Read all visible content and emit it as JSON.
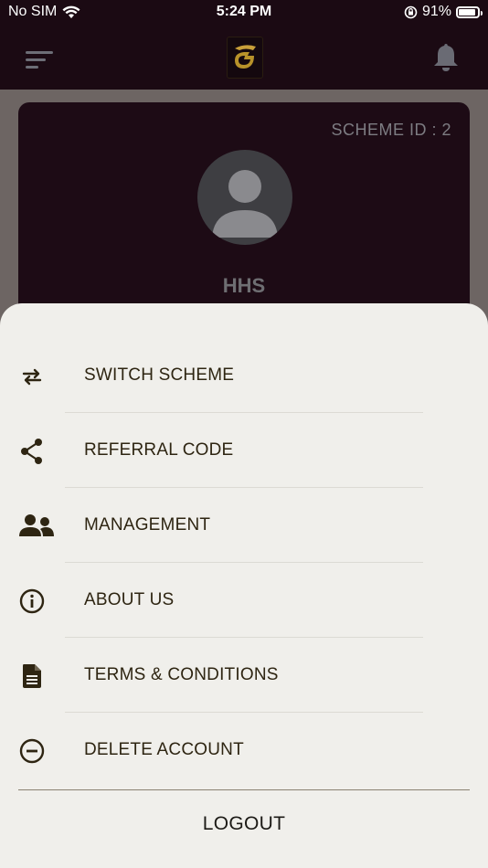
{
  "status_bar": {
    "carrier": "No SIM",
    "time": "5:24 PM",
    "battery": "91%",
    "battery_level": 0.91
  },
  "header": {
    "logo_icon": "g-logo",
    "menu_icon": "menu-icon",
    "bell_icon": "bell-icon"
  },
  "profile": {
    "scheme_id": "SCHEME ID : 2",
    "name": "HHS"
  },
  "menu": {
    "items": [
      {
        "icon": "swap-arrows-icon",
        "label": "SWITCH SCHEME"
      },
      {
        "icon": "share-icon",
        "label": "REFERRAL CODE"
      },
      {
        "icon": "people-icon",
        "label": "MANAGEMENT"
      },
      {
        "icon": "info-icon",
        "label": "ABOUT US"
      },
      {
        "icon": "document-icon",
        "label": "TERMS & CONDITIONS"
      },
      {
        "icon": "minus-circle-icon",
        "label": "DELETE ACCOUNT"
      }
    ],
    "logout": "LOGOUT"
  },
  "colors": {
    "app_bar": "#1b0a13",
    "sheet": "#f0efeb",
    "text": "#2e2512",
    "gold": "#b8922a"
  }
}
